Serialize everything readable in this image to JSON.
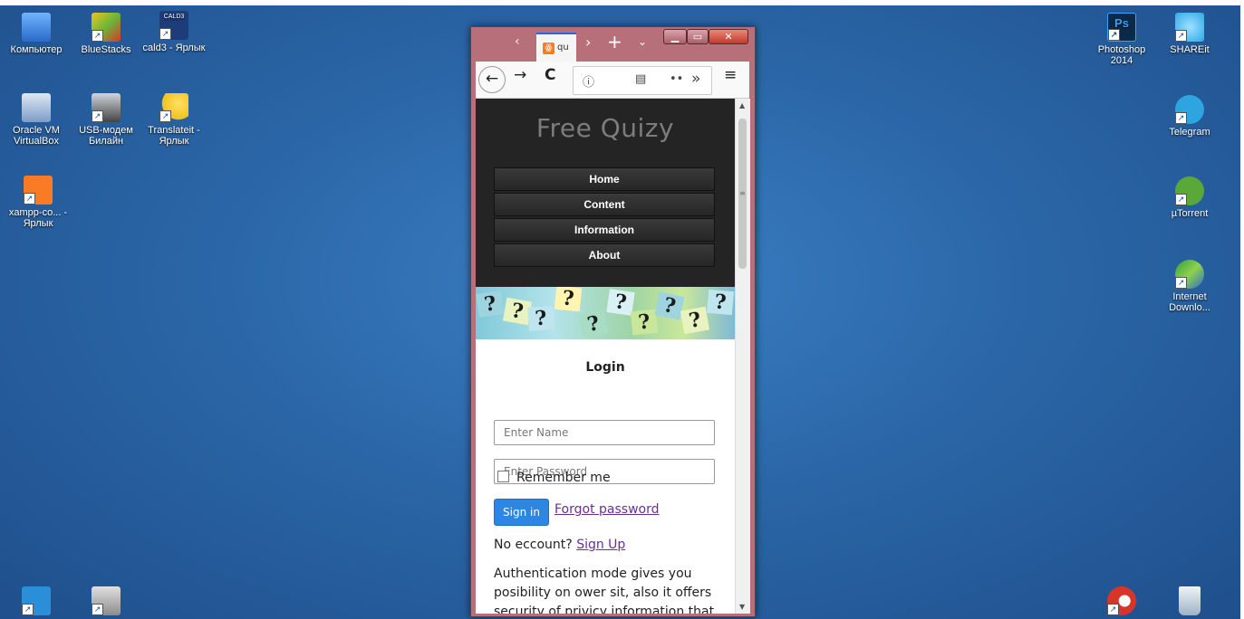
{
  "desktop": {
    "icons_left": [
      {
        "label": "Компьютер",
        "icon": "computer-icon",
        "color": "#3a86d8"
      },
      {
        "label": "BlueStacks",
        "icon": "bluestacks-icon",
        "color": "#6bb63a"
      },
      {
        "label": "cald3 - Ярлык",
        "icon": "cald3-icon",
        "color": "#1e3c7a",
        "badge": "CALD3"
      },
      {
        "label": "Oracle VM VirtualBox",
        "icon": "virtualbox-icon",
        "color": "#3c6ea8"
      },
      {
        "label": "USB-модем Билайн",
        "icon": "usb-modem-icon",
        "color": "#333333"
      },
      {
        "label": "Translateit - Ярлык",
        "icon": "translateit-icon",
        "color": "#f1c21b"
      },
      {
        "label": "xampp-co... - Ярлык",
        "icon": "xampp-icon",
        "color": "#fb7a24"
      }
    ],
    "icons_right": [
      {
        "label": "Photoshop 2014",
        "icon": "photoshop-icon",
        "color": "#0b2a4a",
        "badge": "Ps"
      },
      {
        "label": "SHAREit",
        "icon": "shareit-icon",
        "color": "#2fa9e6"
      },
      {
        "label": "Telegram",
        "icon": "telegram-icon",
        "color": "#2ca5e0"
      },
      {
        "label": "µTorrent",
        "icon": "utorrent-icon",
        "color": "#5aa83a"
      },
      {
        "label": "Internet Downlo...",
        "icon": "internet-download-manager-icon",
        "color": "#2f9e3a"
      }
    ],
    "taskbar_icons": [
      {
        "icon": "video-player-icon",
        "color": "#2a8fd8"
      },
      {
        "icon": "app-installer-icon",
        "color": "#8c8c8c"
      },
      {
        "icon": "ccleaner-icon",
        "color": "#d8352a"
      },
      {
        "icon": "recycle-bin-icon",
        "color": "#bfc9d4"
      }
    ]
  },
  "browser": {
    "tab": {
      "title": "qu",
      "favicon_letter": "ꙮ"
    },
    "toolbar": {
      "back": "←",
      "forward": "→",
      "reload": "C",
      "info": "ⓘ",
      "reader": "▤",
      "more": "••",
      "overflow": "»",
      "menu": "≡"
    },
    "window_controls": {
      "minimize": "▁",
      "maximize": "▭",
      "close": "✕"
    }
  },
  "page": {
    "site_title": "Free Quizy",
    "menu": [
      "Home",
      "Content",
      "Information",
      "About"
    ],
    "login": {
      "title": "Login",
      "name_placeholder": "Enter Name",
      "password_placeholder": "Enter Password",
      "remember": "Remember me",
      "signin": "Sign in",
      "forgot": "Forgot password",
      "no_account": "No eccount?",
      "signup": "Sign Up",
      "auth_text": "Authentication mode gives you posibility on ower sit, also it offers security of privicy information that"
    }
  }
}
